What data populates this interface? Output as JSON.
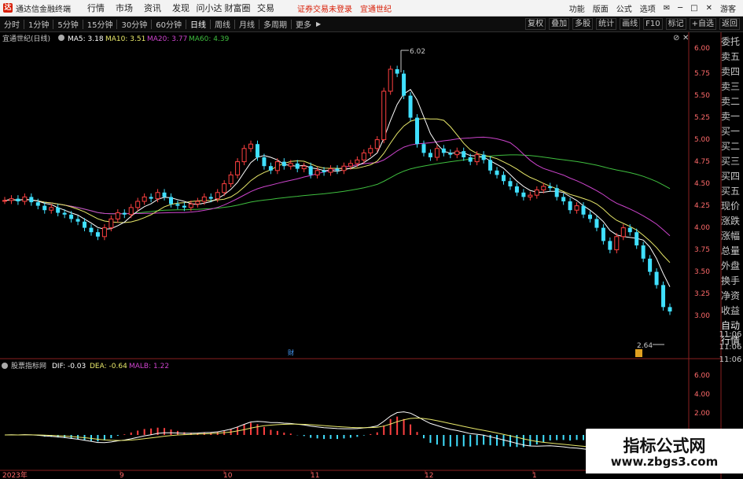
{
  "titlebar": {
    "app_title": "通达信金融终端",
    "menu": [
      "行情",
      "市场",
      "资讯",
      "发现",
      "问小达",
      "财富圈",
      "交易"
    ],
    "notice_account": "证券交易未登录",
    "notice_stock": "宜通世纪",
    "tools": [
      "功能",
      "版面",
      "公式",
      "选项"
    ],
    "guest": "游客"
  },
  "toolbar": {
    "timeframes": [
      "分时",
      "1分钟",
      "5分钟",
      "15分钟",
      "30分钟",
      "60分钟",
      "日线",
      "周线",
      "月线",
      "多周期",
      "更多"
    ],
    "active_timeframe": "日线",
    "right_buttons": [
      "复权",
      "叠加",
      "多股",
      "统计",
      "画线",
      "F10",
      "标记",
      "+自选",
      "返回"
    ]
  },
  "main_chart": {
    "stock_label": "宜通世纪(日线)",
    "ma": [
      {
        "label": "MA5: 3.18",
        "color": "#ffffff"
      },
      {
        "label": "MA10: 3.51",
        "color": "#e8e86a"
      },
      {
        "label": "MA20: 3.77",
        "color": "#cc44cc"
      },
      {
        "label": "MA60: 4.39",
        "color": "#3fbf3f"
      }
    ],
    "y_ticks": [
      "6.00",
      "5.75",
      "5.50",
      "5.25",
      "5.00",
      "4.75",
      "4.50",
      "4.25",
      "4.00",
      "3.75",
      "3.50",
      "3.25",
      "3.00",
      "11:06",
      "11:06",
      "11:06"
    ],
    "high_label": "6.02",
    "low_label": "2.64",
    "marker_label": "财"
  },
  "sub_chart": {
    "indicator_label": "股票指标网",
    "dif": "DIF: -0.03",
    "dea": "DEA: -0.64",
    "malb": "MALB: 1.22",
    "y_ticks": [
      "6.00",
      "4.00",
      "2.00"
    ]
  },
  "x_axis": [
    "2023年",
    "9",
    "10",
    "11",
    "12",
    "1"
  ],
  "right_panel": [
    "委托",
    "卖五",
    "卖四",
    "卖三",
    "卖二",
    "卖一",
    "买一",
    "买二",
    "买三",
    "买四",
    "买五",
    "现价",
    "涨跌",
    "涨幅",
    "总量",
    "外盘",
    "换手",
    "净资",
    "收益",
    "自动",
    "行情"
  ],
  "watermark": {
    "line1": "指标公式网",
    "line2": "www.zbgs3.com"
  },
  "colors": {
    "up": "#ff4040",
    "down": "#40e0ff",
    "ma5": "#ffffff",
    "ma10": "#e8e86a",
    "ma20": "#cc44cc",
    "ma60": "#3fbf3f",
    "axis": "#8a2020"
  }
}
